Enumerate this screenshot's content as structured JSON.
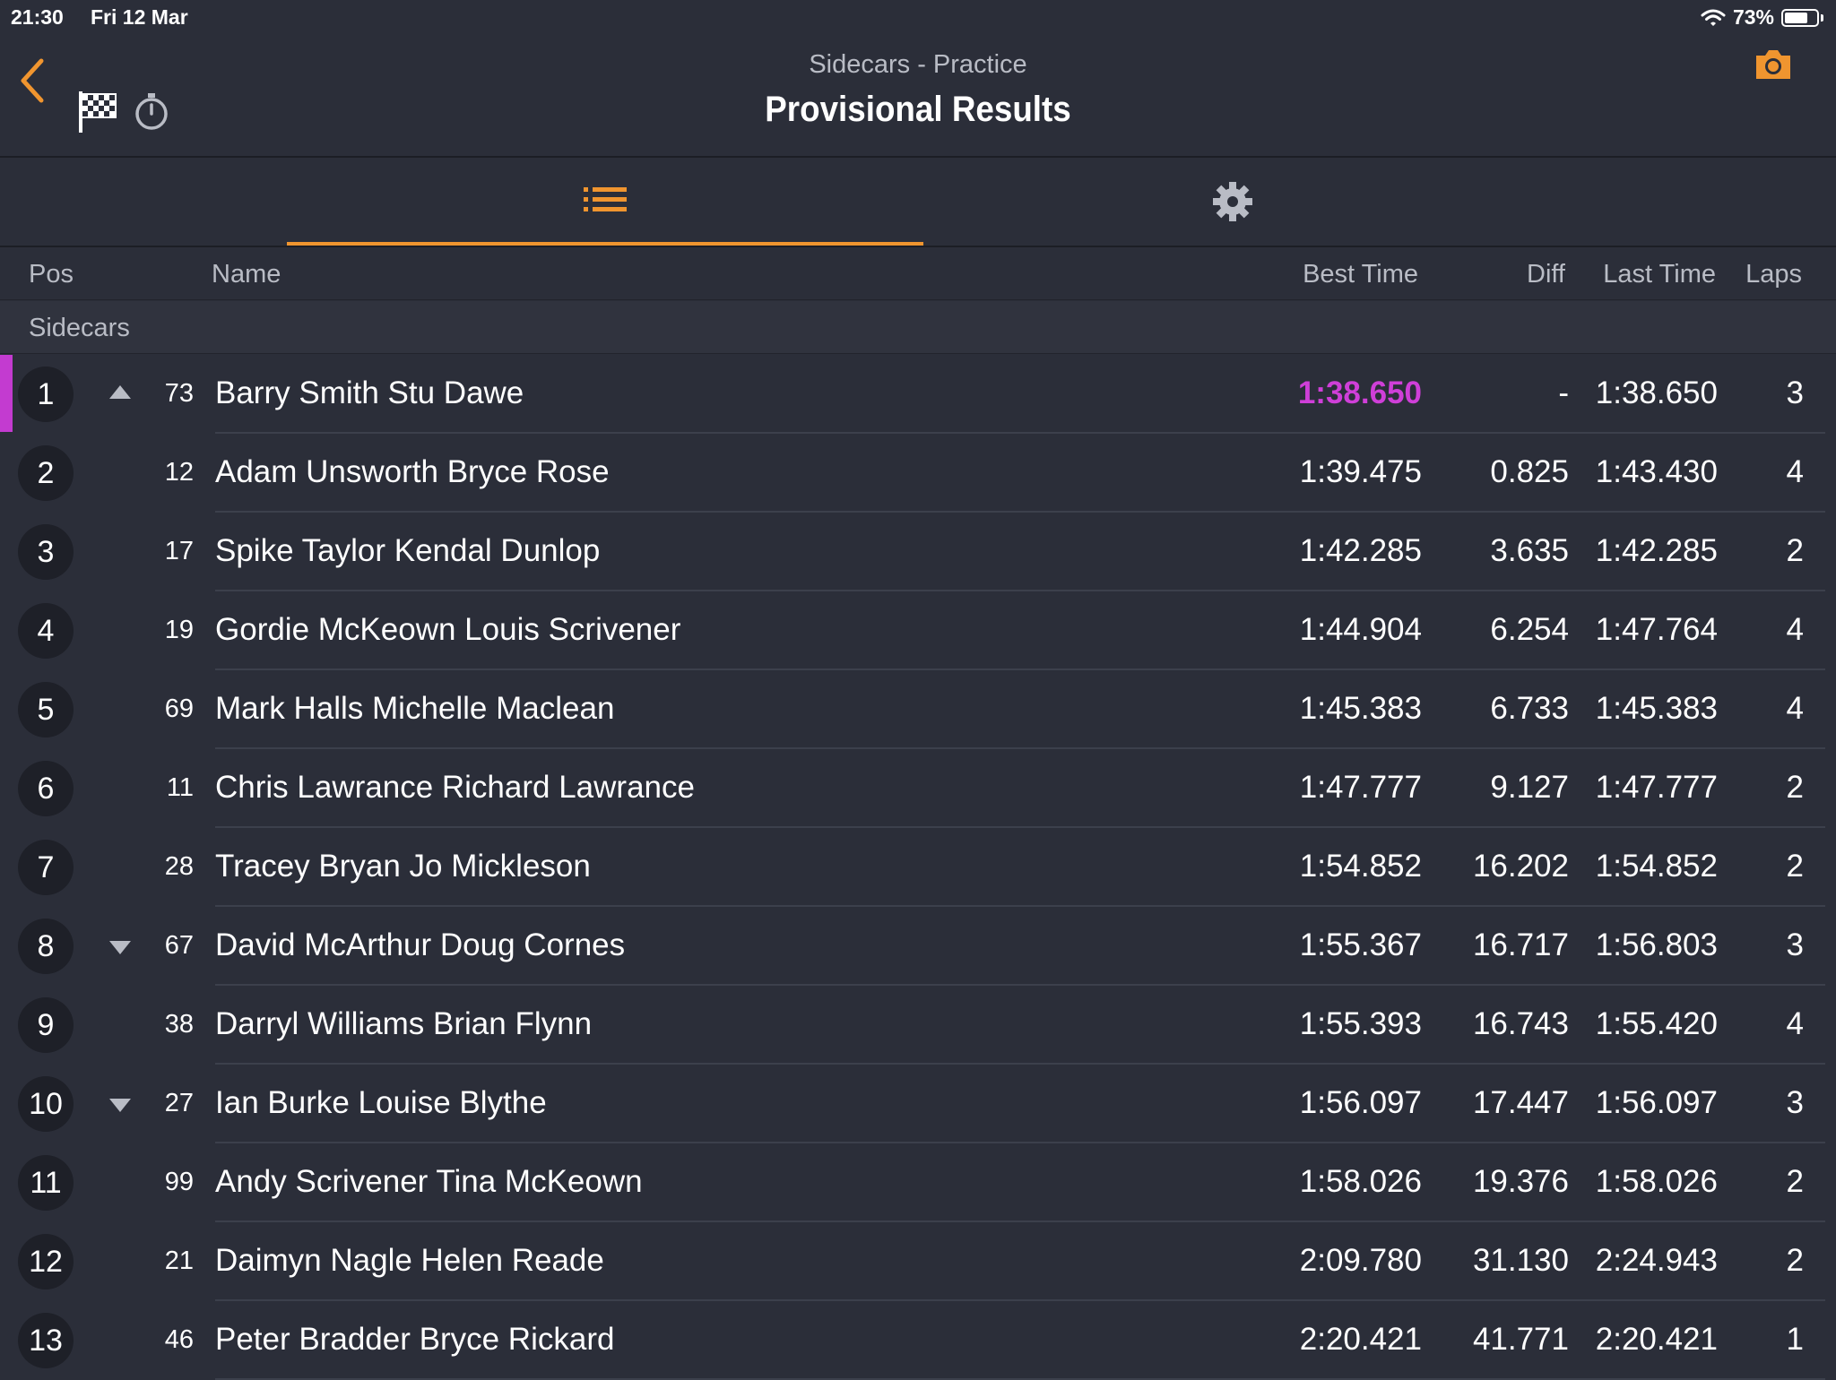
{
  "status": {
    "time": "21:30",
    "date": "Fri 12 Mar",
    "battery": "73%",
    "battery_level": 0.73
  },
  "nav": {
    "subtitle": "Sidecars - Practice",
    "title": "Provisional Results"
  },
  "columns": {
    "pos": "Pos",
    "name": "Name",
    "best": "Best Time",
    "diff": "Diff",
    "last": "Last Time",
    "laps": "Laps"
  },
  "group": "Sidecars",
  "colors": {
    "accent": "#f0952f",
    "fastest": "#cf3fd8",
    "background": "#2b2e39"
  },
  "rows": [
    {
      "pos": "1",
      "trend": "up",
      "num": "73",
      "name": "Barry Smith Stu Dawe",
      "best": "1:38.650",
      "diff": "-",
      "last": "1:38.650",
      "laps": "3",
      "fastest": true
    },
    {
      "pos": "2",
      "trend": "",
      "num": "12",
      "name": "Adam Unsworth Bryce Rose",
      "best": "1:39.475",
      "diff": "0.825",
      "last": "1:43.430",
      "laps": "4"
    },
    {
      "pos": "3",
      "trend": "",
      "num": "17",
      "name": "Spike Taylor Kendal Dunlop",
      "best": "1:42.285",
      "diff": "3.635",
      "last": "1:42.285",
      "laps": "2"
    },
    {
      "pos": "4",
      "trend": "",
      "num": "19",
      "name": "Gordie McKeown Louis Scrivener",
      "best": "1:44.904",
      "diff": "6.254",
      "last": "1:47.764",
      "laps": "4"
    },
    {
      "pos": "5",
      "trend": "",
      "num": "69",
      "name": "Mark Halls Michelle Maclean",
      "best": "1:45.383",
      "diff": "6.733",
      "last": "1:45.383",
      "laps": "4"
    },
    {
      "pos": "6",
      "trend": "",
      "num": "11",
      "name": "Chris Lawrance Richard Lawrance",
      "best": "1:47.777",
      "diff": "9.127",
      "last": "1:47.777",
      "laps": "2"
    },
    {
      "pos": "7",
      "trend": "",
      "num": "28",
      "name": "Tracey Bryan Jo Mickleson",
      "best": "1:54.852",
      "diff": "16.202",
      "last": "1:54.852",
      "laps": "2"
    },
    {
      "pos": "8",
      "trend": "down",
      "num": "67",
      "name": "David McArthur Doug Cornes",
      "best": "1:55.367",
      "diff": "16.717",
      "last": "1:56.803",
      "laps": "3"
    },
    {
      "pos": "9",
      "trend": "",
      "num": "38",
      "name": "Darryl Williams Brian Flynn",
      "best": "1:55.393",
      "diff": "16.743",
      "last": "1:55.420",
      "laps": "4"
    },
    {
      "pos": "10",
      "trend": "down",
      "num": "27",
      "name": "Ian Burke Louise Blythe",
      "best": "1:56.097",
      "diff": "17.447",
      "last": "1:56.097",
      "laps": "3"
    },
    {
      "pos": "11",
      "trend": "",
      "num": "99",
      "name": "Andy Scrivener Tina McKeown",
      "best": "1:58.026",
      "diff": "19.376",
      "last": "1:58.026",
      "laps": "2"
    },
    {
      "pos": "12",
      "trend": "",
      "num": "21",
      "name": "Daimyn Nagle Helen Reade",
      "best": "2:09.780",
      "diff": "31.130",
      "last": "2:24.943",
      "laps": "2"
    },
    {
      "pos": "13",
      "trend": "",
      "num": "46",
      "name": "Peter Bradder Bryce Rickard",
      "best": "2:20.421",
      "diff": "41.771",
      "last": "2:20.421",
      "laps": "1"
    }
  ]
}
